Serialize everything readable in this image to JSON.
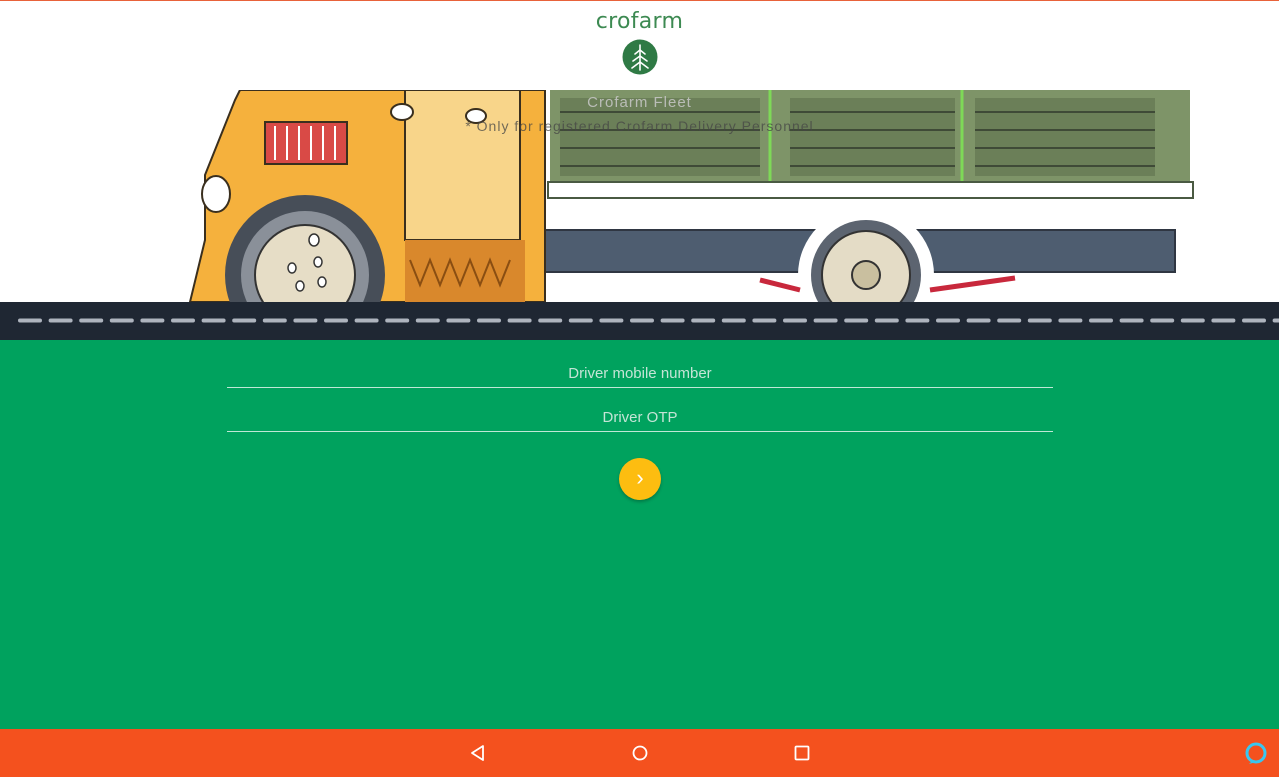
{
  "brand": {
    "name": "crofarm",
    "color": "#3d8a52"
  },
  "hero": {
    "title": "Crofarm Fleet",
    "subtitle": "* Only for registered Crofarm Delivery Personnel"
  },
  "form": {
    "mobile_placeholder": "Driver mobile number",
    "otp_placeholder": "Driver OTP",
    "submit_label": "›",
    "background": "#00a25e",
    "button_color": "#fdbd10"
  },
  "system_nav": {
    "back_icon": "back-triangle-icon",
    "home_icon": "home-circle-icon",
    "recents_icon": "recents-square-icon",
    "assistant_icon": "assistant-ring-icon",
    "background": "#f4511e"
  }
}
